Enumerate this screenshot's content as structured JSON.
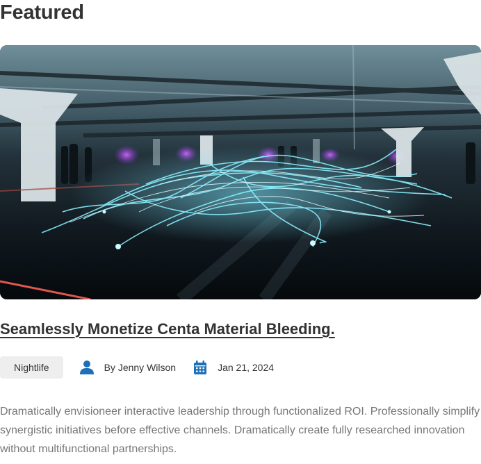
{
  "section": {
    "title": "Featured"
  },
  "post": {
    "image_alt": "Long exposure light trails in a parking garage",
    "title": "Seamlessly Monetize Centa Material Bleeding.",
    "category": "Nightlife",
    "author_icon": "user-icon",
    "author": "By Jenny Wilson",
    "date_icon": "calendar-icon",
    "date": "Jan 21, 2024",
    "excerpt": "Dramatically envisioneer interactive leadership through functionalized ROI. Professionally simplify synergistic initiatives before effective channels. Dramatically create fully researched innovation without multifunctional partnerships."
  },
  "colors": {
    "heading": "#333333",
    "body_text": "#777777",
    "badge_bg": "#eeeeee",
    "icon_accent": "#1d6fb8"
  }
}
